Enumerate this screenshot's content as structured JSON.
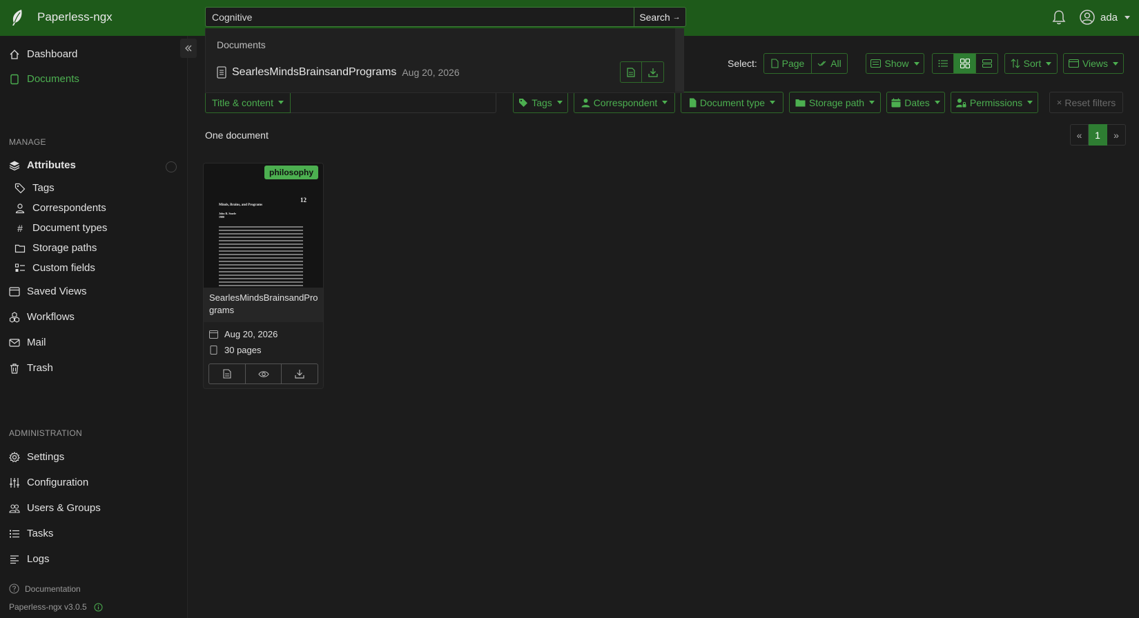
{
  "app": {
    "name": "Paperless-ngx",
    "version": "Paperless-ngx v3.0.5"
  },
  "search": {
    "value": "Cognitive",
    "button_label": "Search",
    "button_arrow": "→"
  },
  "search_dropdown": {
    "heading": "Documents",
    "result": {
      "title": "SearlesMindsBrainsandPrograms",
      "date": "Aug 20, 2026"
    }
  },
  "user": {
    "name": "ada"
  },
  "sidebar": {
    "main": [
      {
        "label": "Dashboard",
        "icon": "house-icon"
      },
      {
        "label": "Documents",
        "icon": "file-icon",
        "active": true
      }
    ],
    "manage_heading": "MANAGE",
    "attributes": {
      "label": "Attributes",
      "items": [
        {
          "label": "Tags",
          "icon": "tag-icon"
        },
        {
          "label": "Correspondents",
          "icon": "person-icon"
        },
        {
          "label": "Document types",
          "icon": "hash-icon"
        },
        {
          "label": "Storage paths",
          "icon": "folder-icon"
        },
        {
          "label": "Custom fields",
          "icon": "ui-checks-icon"
        }
      ]
    },
    "manage_items": [
      {
        "label": "Saved Views",
        "icon": "window-icon"
      },
      {
        "label": "Workflows",
        "icon": "boxes-icon"
      },
      {
        "label": "Mail",
        "icon": "envelope-icon"
      },
      {
        "label": "Trash",
        "icon": "trash-icon"
      }
    ],
    "admin_heading": "ADMINISTRATION",
    "admin_items": [
      {
        "label": "Settings",
        "icon": "gear-icon"
      },
      {
        "label": "Configuration",
        "icon": "sliders-icon"
      },
      {
        "label": "Users & Groups",
        "icon": "people-icon"
      },
      {
        "label": "Tasks",
        "icon": "list-task-icon"
      },
      {
        "label": "Logs",
        "icon": "text-left-icon"
      }
    ],
    "documentation": "Documentation"
  },
  "toolbar": {
    "select_label": "Select:",
    "page_label": "Page",
    "all_label": "All",
    "show_label": "Show",
    "sort_label": "Sort",
    "views_label": "Views",
    "display_mode": "small-cards"
  },
  "filters": {
    "text_filter_type": "Title & content",
    "tags": "Tags",
    "correspondent": "Correspondent",
    "document_type": "Document type",
    "storage_path": "Storage path",
    "dates": "Dates",
    "permissions": "Permissions",
    "reset": "Reset filters"
  },
  "results": {
    "count_label": "One document",
    "pagination": {
      "prev": "«",
      "current": "1",
      "next": "»"
    }
  },
  "document": {
    "tag": "philosophy",
    "tag_color": "#4caf50",
    "title": "SearlesMindsBrainsandPrograms",
    "date": "Aug 20, 2026",
    "pages": "30 pages",
    "thumb": {
      "page_number": "12",
      "heading": "Minds, Brains, and Programs",
      "author": "John R. Searle",
      "year": "1980"
    }
  },
  "colors": {
    "topbar": "#1e5a1a",
    "accent": "#4caf50",
    "background": "#1c1c1c"
  }
}
